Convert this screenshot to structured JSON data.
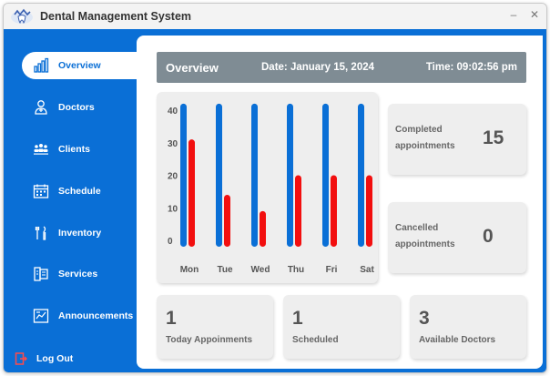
{
  "window": {
    "title": "Dental Management System",
    "minimize": "–",
    "close": "✕"
  },
  "sidebar": {
    "items": [
      {
        "label": "Overview",
        "icon": "bar-chart-icon",
        "active": true
      },
      {
        "label": "Doctors",
        "icon": "doctor-icon"
      },
      {
        "label": "Clients",
        "icon": "people-icon"
      },
      {
        "label": "Schedule",
        "icon": "calendar-icon"
      },
      {
        "label": "Inventory",
        "icon": "tools-icon"
      },
      {
        "label": "Services",
        "icon": "services-icon"
      },
      {
        "label": "Announcements",
        "icon": "announcement-icon"
      }
    ],
    "logout": "Log Out"
  },
  "overview": {
    "title": "Overview",
    "date": "Date: January 15, 2024",
    "time": "Time: 09:02:56 pm"
  },
  "stats": {
    "completed": {
      "label": "Completed appointments",
      "value": "15"
    },
    "cancelled": {
      "label": "Cancelled appointments",
      "value": "0"
    },
    "today": {
      "label": "Today Appoinments",
      "value": "1"
    },
    "scheduled": {
      "label": "Scheduled",
      "value": "1"
    },
    "doctors": {
      "label": "Available Doctors",
      "value": "3"
    }
  },
  "colors": {
    "accent": "#0a6fd6",
    "series_blue": "#0a6fd6",
    "series_red": "#f20f0f"
  },
  "chart_data": {
    "type": "bar",
    "categories": [
      "Mon",
      "Tue",
      "Wed",
      "Thu",
      "Fri",
      "Sat"
    ],
    "series": [
      {
        "values": [
          42,
          42,
          42,
          42,
          42,
          42
        ],
        "color": "#0a6fd6"
      },
      {
        "values": [
          31,
          14,
          9,
          20,
          20,
          20
        ],
        "color": "#f20f0f"
      }
    ],
    "yticks": [
      0,
      10,
      20,
      30,
      40
    ],
    "ylim": [
      0,
      42
    ],
    "grid": false
  }
}
